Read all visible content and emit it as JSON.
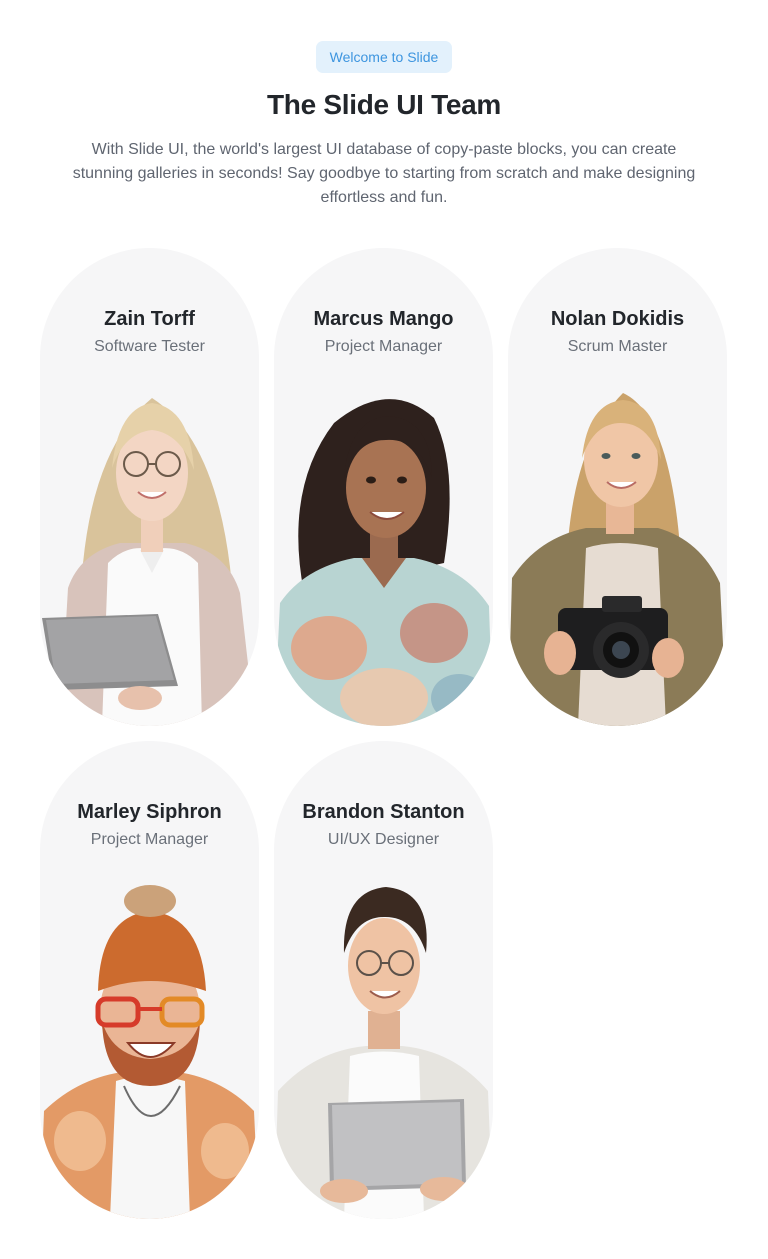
{
  "header": {
    "badge": "Welcome to Slide",
    "title": "The Slide UI Team",
    "description": "With Slide UI, the world's largest UI database of copy-paste blocks, you can create stunning galleries in seconds! Say goodbye to starting from scratch and make designing effortless and fun."
  },
  "team": [
    {
      "name": "Zain Torff",
      "role": "Software Tester"
    },
    {
      "name": "Marcus Mango",
      "role": "Project Manager"
    },
    {
      "name": "Nolan Dokidis",
      "role": "Scrum Master"
    },
    {
      "name": "Marley Siphron",
      "role": "Project Manager"
    },
    {
      "name": "Brandon Stanton",
      "role": "UI/UX Designer"
    }
  ],
  "colors": {
    "badge_bg": "#e3f1fc",
    "badge_text": "#3d95df",
    "card_bg": "#f6f6f7",
    "heading": "#22262b",
    "muted": "#6a7079"
  }
}
